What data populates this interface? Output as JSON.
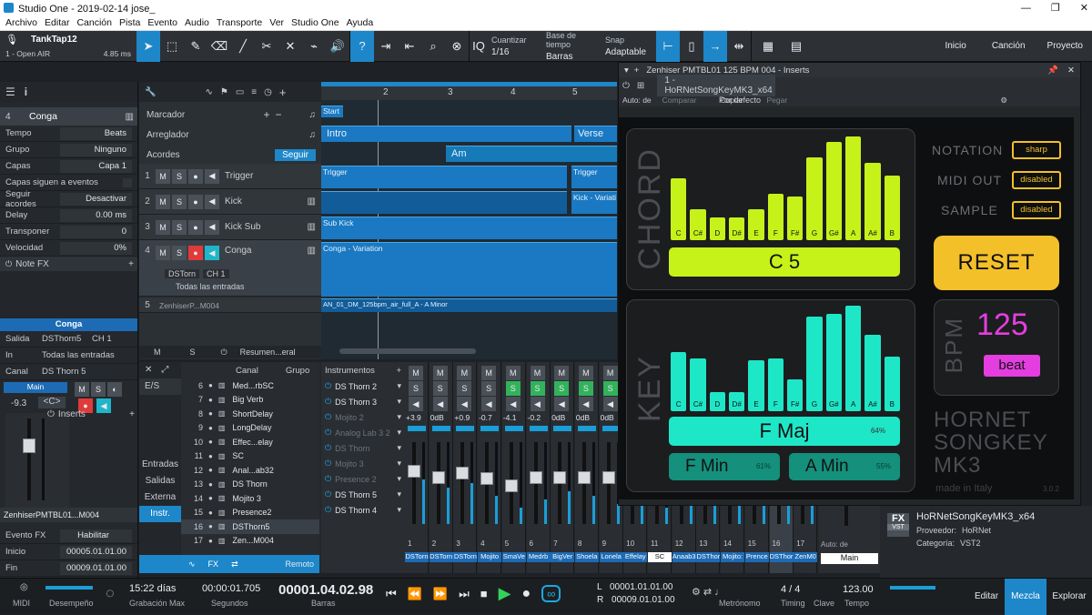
{
  "window": {
    "title": "Studio One - 2019-02-14 jose_",
    "controls": [
      "—",
      "❐",
      "✕"
    ]
  },
  "menu": [
    "Archivo",
    "Editar",
    "Canción",
    "Pista",
    "Evento",
    "Audio",
    "Transporte",
    "Ver",
    "Studio One",
    "Ayuda"
  ],
  "toolbar": {
    "device": "TankTap12",
    "device_sub": "1 - Open AIR",
    "latency": "4.85 ms",
    "quantize_label": "Cuantizar",
    "quantize_value": "1/16",
    "timebase_label": "Base de tiempo",
    "timebase_value": "Barras",
    "snap_label": "Snap",
    "snap_value": "Adaptable",
    "iq": "IQ",
    "right": {
      "start": "Inicio",
      "song": "Canción",
      "project": "Proyecto"
    }
  },
  "left_panel": {
    "track_num": "4",
    "track_name": "Conga",
    "rows": [
      {
        "k": "Tempo",
        "v": "Beats"
      },
      {
        "k": "Grupo",
        "v": "Ninguno"
      },
      {
        "k": "Capas",
        "v": "Capa 1"
      },
      {
        "k": "Capas siguen a eventos",
        "v": ""
      },
      {
        "k": "Seguir acordes",
        "v": "Desactivar"
      },
      {
        "k": "Delay",
        "v": "0.00 ms"
      },
      {
        "k": "Transponer",
        "v": "0"
      },
      {
        "k": "Velocidad",
        "v": "0%"
      }
    ],
    "notefx": "Note FX",
    "channel_title": "Conga",
    "out_label": "Salida",
    "out_value": "DSThorn5",
    "out_ch": "CH 1",
    "in_label": "In",
    "in_value": "Todas las entradas",
    "canal_label": "Canal",
    "canal_value": "DS Thorn 5",
    "main": "Main",
    "vol": "-9.3",
    "pan": "<C>",
    "inserts": "Inserts",
    "plugin_name": "ZenhiserPMTBL01...M004",
    "evento_fx": "Evento FX",
    "habilitar": "Habilitar",
    "inicio_label": "Inicio",
    "inicio_value": "00005.01.01.00",
    "fin_label": "Fin",
    "fin_value": "00009.01.01.00"
  },
  "arranger": {
    "marcador": "Marcador",
    "arreglador": "Arreglador",
    "acordes": "Acordes",
    "seguir": "Seguir",
    "ruler": [
      "2",
      "3",
      "4",
      "5"
    ],
    "start_marker": "Start",
    "sections": [
      {
        "label": "Intro"
      },
      {
        "label": "Verse"
      }
    ],
    "chord": "Am",
    "tracks": [
      {
        "n": "1",
        "name": "Trigger"
      },
      {
        "n": "2",
        "name": "Kick"
      },
      {
        "n": "3",
        "name": "Kick Sub"
      },
      {
        "n": "4",
        "name": "Conga"
      },
      {
        "n": "5",
        "name": "ZenhiserP...M004"
      }
    ],
    "conga_out": "DSTorn",
    "conga_ch": "CH 1",
    "conga_in": "Todas las entradas",
    "clips": {
      "trigger": "Trigger",
      "trigger2": "Trigger",
      "kick2": "Kick - Variati",
      "subkick": "Sub Kick",
      "conga": "Conga - Variation",
      "audio": "AN_01_DM_125bpm_air_full_A - A Minor"
    },
    "footer": {
      "m": "M",
      "s": "S",
      "resumen": "Resumen...eral"
    }
  },
  "mixer": {
    "headers": {
      "canal": "Canal",
      "grupo": "Grupo",
      "instrumentos": "Instrumentos"
    },
    "side": [
      "E/S",
      "Entradas",
      "Salidas",
      "Externa",
      "Instr."
    ],
    "list": [
      {
        "n": "6",
        "name": "Med...rbSC"
      },
      {
        "n": "7",
        "name": "Big Verb"
      },
      {
        "n": "8",
        "name": "ShortDelay"
      },
      {
        "n": "9",
        "name": "LongDelay"
      },
      {
        "n": "10",
        "name": "Effec...elay"
      },
      {
        "n": "11",
        "name": "SC"
      },
      {
        "n": "12",
        "name": "Anal...ab32"
      },
      {
        "n": "13",
        "name": "DS Thorn"
      },
      {
        "n": "14",
        "name": "Mojito 3"
      },
      {
        "n": "15",
        "name": "Presence2"
      },
      {
        "n": "16",
        "name": "DSThorn5"
      },
      {
        "n": "17",
        "name": "Zen...M004"
      }
    ],
    "instruments": [
      "DS Thorn 2",
      "DS Thorn 3",
      "Mojito 2",
      "Analog Lab 3 2",
      "DS Thorn",
      "Mojito 3",
      "Presence 2",
      "DS Thorn 5",
      "DS Thorn 4"
    ],
    "remoto": "Remoto",
    "channels": [
      {
        "n": "1",
        "vol": "+3.9",
        "name": "DSTorn",
        "fader": 0.72,
        "level": 0.55
      },
      {
        "n": "2",
        "vol": "0dB",
        "name": "DSTorn",
        "fader": 0.65,
        "level": 0.45
      },
      {
        "n": "3",
        "vol": "+0.9",
        "name": "DSTorn",
        "fader": 0.7,
        "level": 0.5
      },
      {
        "n": "4",
        "vol": "-0.7",
        "name": "Mojito",
        "fader": 0.63,
        "level": 0.35
      },
      {
        "n": "5",
        "vol": "-4.1",
        "name": "SmaVe",
        "fader": 0.55,
        "level": 0.2
      },
      {
        "n": "6",
        "vol": "-0.2",
        "name": "Medrb",
        "fader": 0.64,
        "level": 0.3
      },
      {
        "n": "7",
        "vol": "0dB",
        "name": "BigVer",
        "fader": 0.65,
        "level": 0.4
      },
      {
        "n": "8",
        "vol": "0dB",
        "name": "Shoela",
        "fader": 0.65,
        "level": 0.35
      },
      {
        "n": "9",
        "vol": "0dB",
        "name": "Lonela",
        "fader": 0.65,
        "level": 0.25
      },
      {
        "n": "10",
        "vol": "",
        "name": "Effelay",
        "fader": 0.65,
        "level": 0.3
      },
      {
        "n": "11",
        "vol": "",
        "name": "SC",
        "fader": 0.65,
        "level": 0.2
      },
      {
        "n": "12",
        "vol": "",
        "name": "Anaab3",
        "fader": 0.65,
        "level": 0.3
      },
      {
        "n": "13",
        "vol": "",
        "name": "DSThor",
        "fader": 0.65,
        "level": 0.4
      },
      {
        "n": "14",
        "vol": "",
        "name": "Mojito:",
        "fader": 0.65,
        "level": 0.35
      },
      {
        "n": "15",
        "vol": "",
        "name": "Prence",
        "fader": 0.65,
        "level": 0.3
      },
      {
        "n": "16",
        "vol": "",
        "name": "DSThor",
        "fader": 0.65,
        "level": 0.5
      },
      {
        "n": "17",
        "vol": "",
        "name": "ZenM0",
        "fader": 0.65,
        "level": 0.45
      }
    ],
    "main_label": "Main",
    "auto": "Auto: de"
  },
  "plugin": {
    "title": "Zenhiser PMTBL01 125 BPM 004 - Inserts",
    "preset": "1 - HoRNetSongKeyMK3_x64",
    "default": "Por defecto",
    "actions": {
      "auto": "Auto: de",
      "compare": "Comparar",
      "copy": "Copiar",
      "paste": "Pegar"
    },
    "chord_label": "CHORD",
    "key_label": "KEY",
    "notes": [
      "C",
      "C#",
      "D",
      "D#",
      "E",
      "F",
      "F#",
      "G",
      "G#",
      "A",
      "A#",
      "B"
    ],
    "chord_levels": [
      0.6,
      0.3,
      0.22,
      0.22,
      0.3,
      0.45,
      0.42,
      0.8,
      0.95,
      1.0,
      0.75,
      0.62
    ],
    "key_levels": [
      0.56,
      0.5,
      0.18,
      0.18,
      0.48,
      0.5,
      0.3,
      0.9,
      0.92,
      1.0,
      0.72,
      0.52
    ],
    "chord_value": "C 5",
    "key_value": "F Maj",
    "key_pct": "64%",
    "alt1": "F Min",
    "alt1_pct": "61%",
    "alt2": "A Min",
    "alt2_pct": "55%",
    "notation_label": "NOTATION",
    "notation_value": "sharp",
    "midiout_label": "MIDI OUT",
    "midiout_value": "disabled",
    "sample_label": "SAMPLE",
    "sample_value": "disabled",
    "reset": "RESET",
    "bpm_label": "BPM",
    "bpm_value": "125",
    "bpm_mode": "beat",
    "brand1": "HORNET",
    "brand2": "SONGKEY",
    "brand3": "MK3",
    "made": "made in Italy",
    "version": "3.0.2",
    "colors": {
      "chord": "#c6f219",
      "key": "#1ee7c8",
      "reset": "#f4c02a",
      "bpm": "#e43ee0"
    }
  },
  "browser": {
    "name": "HoRNetSongKeyMK3_x64",
    "provider_label": "Proveedor:",
    "provider": "HoRNet",
    "cat_label": "Categoría:",
    "cat": "VST2",
    "badge_top": "FX",
    "badge_bot": "VST"
  },
  "transport": {
    "midi": "MIDI",
    "perf": "Desempeño",
    "days": "15:22 días",
    "rec": "Grabación Max",
    "seconds": "00:00:01.705",
    "seconds_label": "Segundos",
    "bars": "00001.04.02.98",
    "bars_label": "Barras",
    "l": "L",
    "r": "R",
    "l_val": "00001.01.01.00",
    "r_val": "00009.01.01.00",
    "metronome": "Metrónomo",
    "timing_val": "4 / 4",
    "timing": "Timing",
    "key": "Clave",
    "tempo_val": "123.00",
    "tempo": "Tempo",
    "edit": "Editar",
    "mix": "Mezcla",
    "browse": "Explorar"
  }
}
